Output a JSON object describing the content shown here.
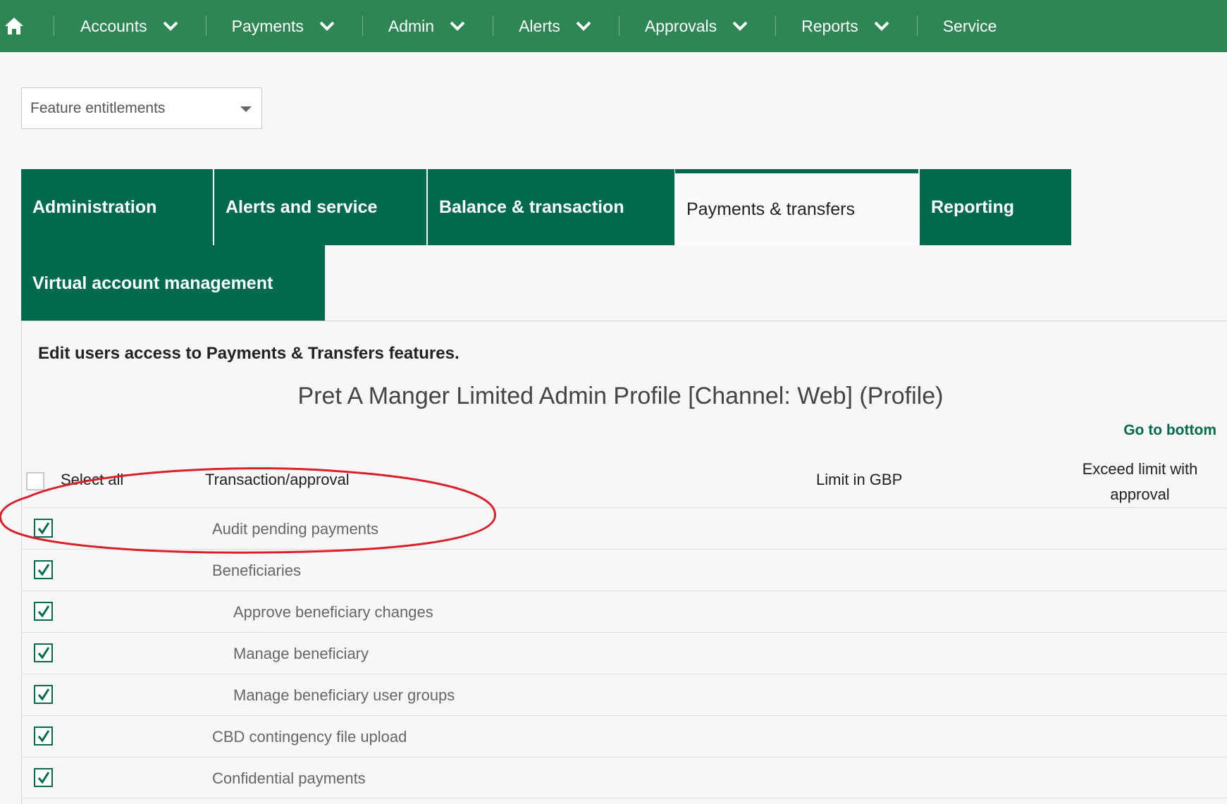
{
  "nav": {
    "items": [
      {
        "label": "Accounts",
        "has_menu": true
      },
      {
        "label": "Payments",
        "has_menu": true
      },
      {
        "label": "Admin",
        "has_menu": true
      },
      {
        "label": "Alerts",
        "has_menu": true
      },
      {
        "label": "Approvals",
        "has_menu": true
      },
      {
        "label": "Reports",
        "has_menu": true
      },
      {
        "label": "Service",
        "has_menu": false
      }
    ]
  },
  "feature_select": {
    "value": "Feature entitlements"
  },
  "tabs": [
    {
      "label": "Administration",
      "active": false
    },
    {
      "label": "Alerts and service",
      "active": false
    },
    {
      "label": "Balance & transaction",
      "active": false
    },
    {
      "label": "Payments & transfers",
      "active": true
    },
    {
      "label": "Reporting",
      "active": false
    },
    {
      "label": "Virtual account management",
      "active": false
    }
  ],
  "intro_text": "Edit users access to Payments & Transfers features.",
  "profile_title": "Pret A Manger Limited Admin Profile [Channel: Web] (Profile)",
  "goto_bottom": "Go to bottom",
  "table": {
    "select_all_label": "Select all",
    "select_all_checked": false,
    "col_transaction": "Transaction/approval",
    "col_limit": "Limit in GBP",
    "col_exceed": "Exceed limit with approval",
    "rows": [
      {
        "label": "Audit pending payments",
        "checked": true,
        "level": 0
      },
      {
        "label": "Beneficiaries",
        "checked": true,
        "level": 0
      },
      {
        "label": "Approve beneficiary changes",
        "checked": true,
        "level": 1
      },
      {
        "label": "Manage beneficiary",
        "checked": true,
        "level": 1
      },
      {
        "label": "Manage beneficiary user groups",
        "checked": true,
        "level": 1
      },
      {
        "label": "CBD contingency file upload",
        "checked": true,
        "level": 0
      },
      {
        "label": "Confidential payments",
        "checked": true,
        "level": 0
      }
    ]
  },
  "colors": {
    "nav_green": "#2d8653",
    "tab_green": "#006a4d",
    "annotation_red": "#d9212b"
  }
}
